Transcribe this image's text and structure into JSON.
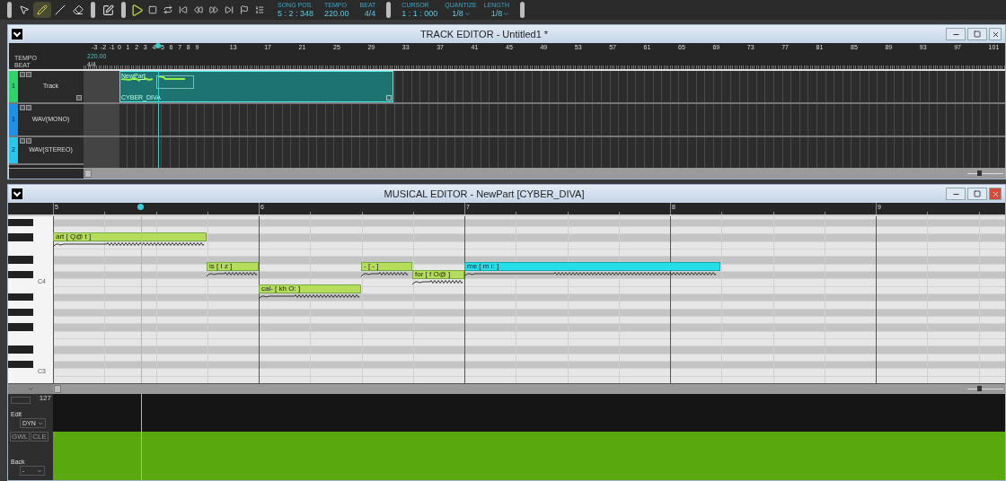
{
  "toolbar": {
    "tools": [
      {
        "kind": "pointer",
        "selected": false
      },
      {
        "kind": "pencil",
        "selected": true
      },
      {
        "kind": "line",
        "selected": false
      },
      {
        "kind": "eraser",
        "selected": false
      }
    ],
    "transport": [
      {
        "kind": "play"
      },
      {
        "kind": "stop"
      },
      {
        "kind": "loop"
      },
      {
        "kind": "start"
      },
      {
        "kind": "rewind"
      },
      {
        "kind": "forward"
      },
      {
        "kind": "end"
      },
      {
        "kind": "marker"
      },
      {
        "kind": "speed"
      }
    ],
    "readouts": [
      {
        "label": "SONG POS.",
        "value": "5 : 2 : 348"
      },
      {
        "label": "TEMPO",
        "value": "220.00"
      },
      {
        "label": "BEAT",
        "value": "4/4"
      }
    ],
    "cursor": {
      "label": "CURSOR",
      "value": "1 : 1 : 000"
    },
    "dropdowns": [
      {
        "label": "QUANTIZE",
        "value": "1/8"
      },
      {
        "label": "LENGTH",
        "value": "1/8"
      }
    ]
  },
  "track_editor": {
    "title": "TRACK EDITOR - Untitled1 *",
    "ruler": {
      "labels": [
        "-3",
        "-2",
        "-1",
        "0",
        "1",
        "2",
        "3",
        "4",
        "5",
        "6",
        "7",
        "8",
        "9",
        "13",
        "17",
        "21",
        "25",
        "29",
        "33",
        "37",
        "41",
        "45",
        "49",
        "53",
        "57",
        "61",
        "65",
        "69",
        "73",
        "77",
        "81",
        "85",
        "89",
        "93",
        "97",
        "101"
      ],
      "tempo_label": "TEMPO",
      "tempo_value": "220.00",
      "beat_label": "BEAT",
      "beat_value": "4/4"
    },
    "tracks": [
      {
        "number": "1",
        "name": "Track",
        "color": "#2fd36a"
      },
      {
        "number": "1",
        "name": "WAV(MONO)",
        "color": "#1e90e6"
      },
      {
        "number": "2",
        "name": "WAV(STEREO)",
        "color": "#27c6ea"
      }
    ],
    "part": {
      "name": "NewPart",
      "singer": "CYBER_DIVA"
    },
    "zoom": {
      "level": 0.3
    }
  },
  "musical_editor": {
    "title": "MUSICAL EDITOR - NewPart [CYBER_DIVA]",
    "measures": [
      "5",
      "6",
      "7",
      "8",
      "9"
    ],
    "keys": [
      "C4",
      "C3"
    ],
    "notes": [
      {
        "lyric": "art [ Q@ t ]",
        "selected": false
      },
      {
        "lyric": "is [ I z ]",
        "selected": false
      },
      {
        "lyric": "cal- [ kh O: ]",
        "selected": false
      },
      {
        "lyric": "- [ - ]",
        "selected": false
      },
      {
        "lyric": "for [ f O@ ]",
        "selected": false
      },
      {
        "lyric": "me [ m i: ]",
        "selected": true
      }
    ],
    "zoom": {
      "level": 0.3
    },
    "control": {
      "max": "127",
      "edit_label": "Edit",
      "parameter": "DYN",
      "buttons": [
        "GWL",
        "CLE"
      ],
      "back_label": "Back",
      "back_value": "-"
    }
  }
}
